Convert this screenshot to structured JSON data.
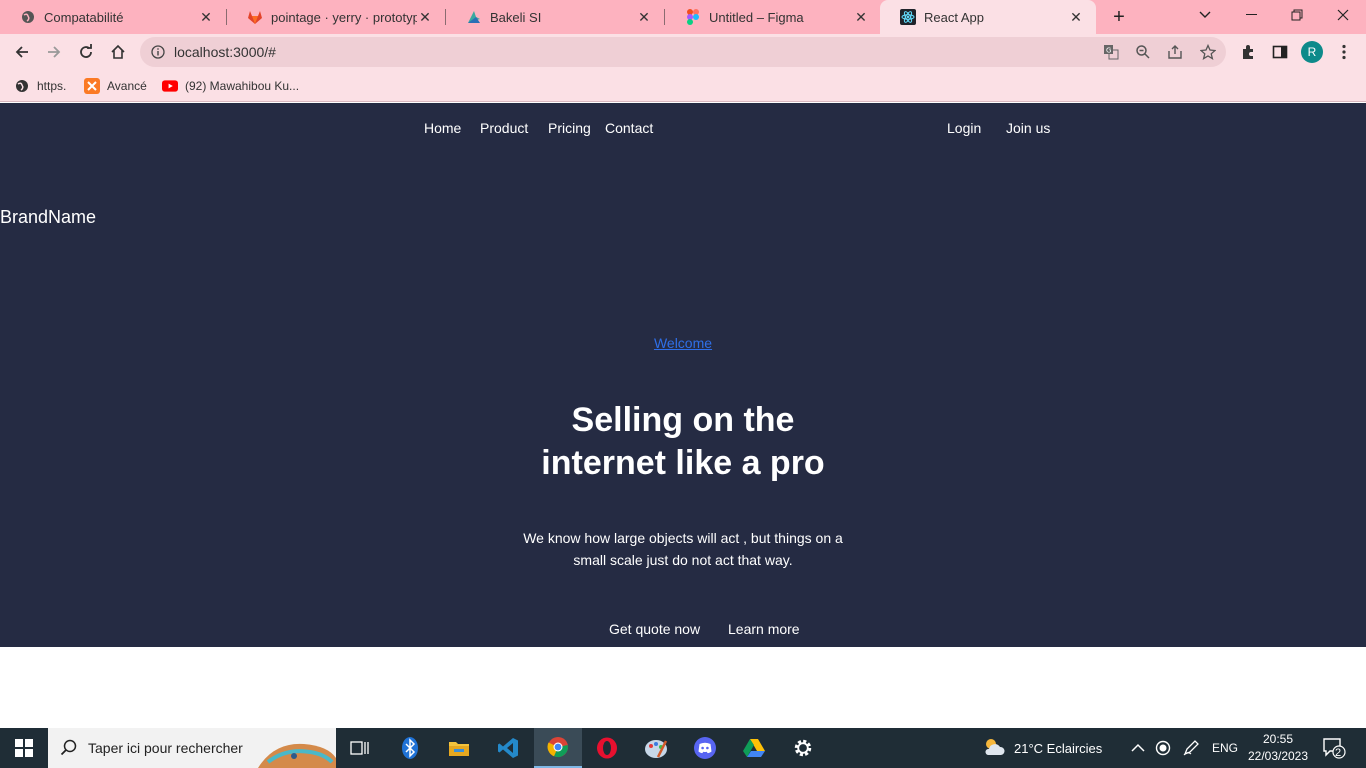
{
  "browser": {
    "tabs": [
      {
        "title": "Compatabilité",
        "icon": "globe-icon"
      },
      {
        "title": "pointage · yerry · prototype /",
        "icon": "gitlab-icon"
      },
      {
        "title": "Bakeli SI",
        "icon": "bakeli-icon"
      },
      {
        "title": "Untitled – Figma",
        "icon": "figma-icon"
      },
      {
        "title": "React App",
        "icon": "react-icon"
      }
    ],
    "active_tab": 4,
    "url": "localhost:3000/#",
    "profile_initial": "R",
    "bookmarks": [
      {
        "label": "https.",
        "icon": "globe-icon"
      },
      {
        "label": "Avancé",
        "icon": "xampp-icon"
      },
      {
        "label": "(92) Mawahibou Ku...",
        "icon": "youtube-icon"
      }
    ]
  },
  "site": {
    "nav": {
      "home": "Home",
      "product": "Product",
      "pricing": "Pricing",
      "contact": "Contact",
      "login": "Login",
      "join": "Join us"
    },
    "brand": "BrandName",
    "welcome": "Welcome",
    "hero_line1": "Selling on the",
    "hero_line2": "internet like a pro",
    "description": "We know how large objects will act , but things on a small scale just do not act that way.",
    "cta_primary": "Get quote now",
    "cta_secondary": "Learn more",
    "colors": {
      "background": "#252b43",
      "link": "#2f6fe8",
      "text": "#ffffff"
    }
  },
  "taskbar": {
    "search_placeholder": "Taper ici pour rechercher",
    "weather": "21°C  Eclaircies",
    "language": "ENG",
    "time": "20:55",
    "date": "22/03/2023",
    "notifications": "2"
  }
}
